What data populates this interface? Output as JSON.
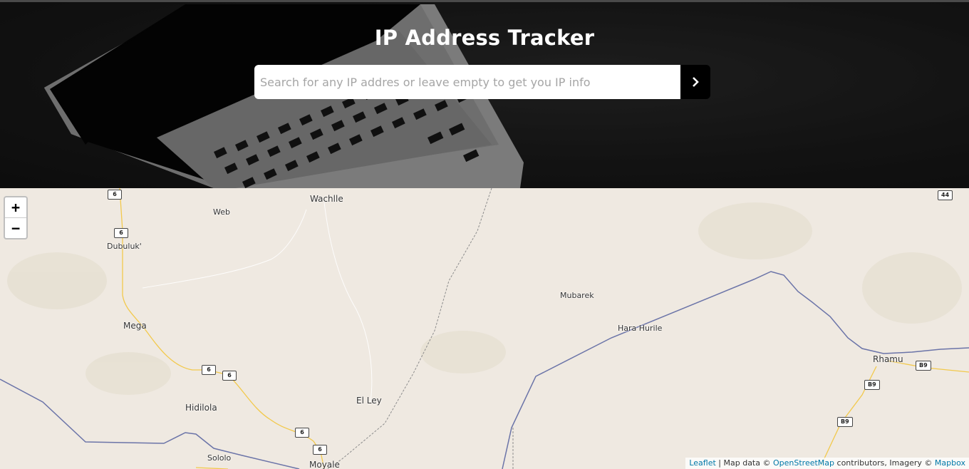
{
  "header": {
    "title": "IP Address Tracker",
    "search": {
      "placeholder": "Search for any IP addres or leave empty to get you IP info",
      "value": ""
    },
    "submit_icon": "chevron-right-icon"
  },
  "map": {
    "zoom_in": "+",
    "zoom_out": "−",
    "places": [
      "Wachlle",
      "Web",
      "Dubuluk'",
      "Mega",
      "Hidilola",
      "Sololo",
      "Moyale",
      "El Ley",
      "Mubarek",
      "Hara Hurile",
      "Rhamu"
    ],
    "road_shields": [
      "6",
      "6",
      "6",
      "6",
      "6",
      "6",
      "6",
      "44",
      "B9",
      "B9",
      "B9"
    ],
    "attribution": {
      "leaflet": "Leaflet",
      "sep1": "| Map data ©",
      "osm": "OpenStreetMap",
      "mid": "contributors, Imagery ©",
      "mapbox": "Mapbox"
    }
  },
  "colors": {
    "hero_bg": "#1d1d1d",
    "title": "#ffffff",
    "button_bg": "#000000",
    "map_bg": "#efe9e1",
    "border_line": "#6b74a8",
    "road": "#f2c94c",
    "link": "#0078a8"
  }
}
